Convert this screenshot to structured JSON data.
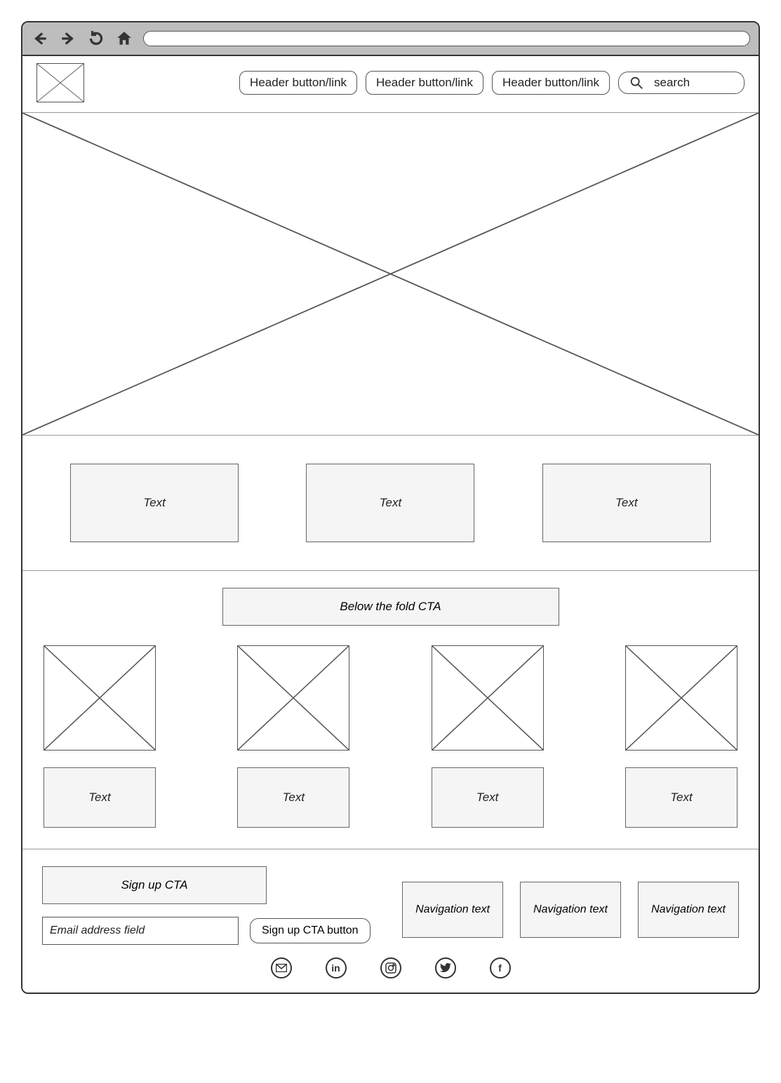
{
  "browser": {
    "back_icon": "back-arrow-icon",
    "forward_icon": "forward-arrow-icon",
    "refresh_icon": "refresh-icon",
    "home_icon": "home-icon",
    "url": ""
  },
  "header": {
    "nav_buttons": [
      "Header button/link",
      "Header button/link",
      "Header button/link"
    ],
    "search_placeholder": "search"
  },
  "text_row": [
    "Text",
    "Text",
    "Text"
  ],
  "below_fold_cta": "Below the fold CTA",
  "cards": [
    {
      "text": "Text"
    },
    {
      "text": "Text"
    },
    {
      "text": "Text"
    },
    {
      "text": "Text"
    }
  ],
  "footer": {
    "signup_cta": "Sign up CTA",
    "email_placeholder": "Email address field",
    "signup_button": "Sign up CTA button",
    "nav": [
      "Navigation text",
      "Navigation text",
      "Navigation text"
    ],
    "social": [
      "mail-icon",
      "linkedin-icon",
      "instagram-icon",
      "twitter-icon",
      "facebook-icon"
    ]
  }
}
